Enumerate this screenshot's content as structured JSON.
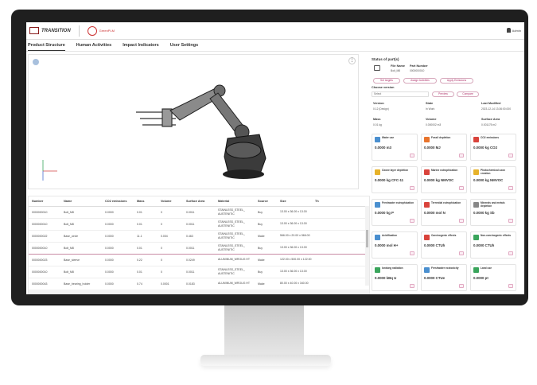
{
  "app": {
    "logo_text": "TRANSITION",
    "brand_text": "GreenPLM",
    "user_name": "Admin"
  },
  "tabs": [
    "Product Structure",
    "Human Activities",
    "Impact Indicators",
    "User Settings"
  ],
  "status": {
    "title": "Status of part(s)",
    "file_name_label": "File Name",
    "file_name_value": "Bolt_M8",
    "part_number_label": "Part Number",
    "part_number_value": "0000000010",
    "actions": [
      "Set targets",
      "Assign Activities",
      "Apply Emissions"
    ],
    "choose_version_label": "Choose version",
    "version_select_value": "Select",
    "preview_label": "Preview",
    "compare_label": "Compare",
    "details": [
      {
        "label": "Version",
        "value": "0.12 (Design)"
      },
      {
        "label": "State",
        "value": "In Work"
      },
      {
        "label": "Last Modified",
        "value": "2023-12-14 13:36:00.000"
      },
      {
        "label": "Mass",
        "value": "0.01 kg"
      },
      {
        "label": "Volume",
        "value": "0.000002 m3"
      },
      {
        "label": "Surface Area",
        "value": "0.001175 m2"
      }
    ]
  },
  "impacts": [
    {
      "title": "Water use",
      "value": "0.0000 m3",
      "color": "#4a8fcf"
    },
    {
      "title": "Fossil depletion",
      "value": "0.0000 MJ",
      "color": "#e8742c"
    },
    {
      "title": "CO2 emissions",
      "value": "0.0000 kg CO2",
      "color": "#d9433b"
    },
    {
      "title": "Ozone layer depletion",
      "value": "0.0000 kg CFC-11",
      "color": "#e6b22a"
    },
    {
      "title": "Marine eutrophication",
      "value": "0.0000 kg NMVOC",
      "color": "#d9433b"
    },
    {
      "title": "Photochemical ozon creation",
      "value": "0.0000 kg NMVOC",
      "color": "#e6b22a"
    },
    {
      "title": "Freshwater eutrophication",
      "value": "0.0000 kg P",
      "color": "#4a8fcf"
    },
    {
      "title": "Terrestial eutrophication",
      "value": "0.0000 mol N",
      "color": "#d9433b"
    },
    {
      "title": "Minerals and metals depletion",
      "value": "0.0000 kg Sb",
      "color": "#888888"
    },
    {
      "title": "Acidification",
      "value": "0.0000 mol H+",
      "color": "#4a8fcf"
    },
    {
      "title": "Carcinogenic effects",
      "value": "0.0000 CTUh",
      "color": "#d9433b"
    },
    {
      "title": "Non-carcinogenic effects",
      "value": "0.0000 CTUh",
      "color": "#3aa55c"
    },
    {
      "title": "Ionising radiation",
      "value": "0.0000 kBq U",
      "color": "#3aa55c"
    },
    {
      "title": "Freshwater ecotoxicity",
      "value": "0.0000 CTUe",
      "color": "#4a8fcf"
    },
    {
      "title": "Land use",
      "value": "0.0000 pt",
      "color": "#3aa55c"
    }
  ],
  "table": {
    "headers": [
      "Number",
      "Name",
      "CO2 emissions",
      "Mass",
      "Volume",
      "Surface Area",
      "Material",
      "Source",
      "Size",
      "Th"
    ],
    "rows": [
      [
        "0000000010",
        "Bolt_M8",
        "0.0000",
        "0.01",
        "0",
        "0.0011",
        "STAINLESS_STEEL_ AUSTENITIC",
        "Buy",
        "13.00 x 36.00 x 13.00"
      ],
      [
        "0000000010",
        "Bolt_M8",
        "0.0000",
        "0.01",
        "0",
        "0.0011",
        "STAINLESS_STEEL_ AUSTENITIC",
        "Buy",
        "13.00 x 36.00 x 13.00"
      ],
      [
        "0000000022",
        "Base_circle",
        "0.0000",
        "11.1",
        "0.004",
        "0.463",
        "STAINLESS_STEEL_ AUSTENITIC",
        "Make",
        "566.00 x 20.00 x 566.00"
      ],
      [
        "0000000010",
        "Bolt_M8",
        "0.0000",
        "0.01",
        "0",
        "0.0011",
        "STAINLESS_STEEL_ AUSTENITIC",
        "Buy",
        "13.00 x 36.00 x 13.00"
      ],
      [
        "0000000023",
        "Base_sleeve",
        "0.0000",
        "0.22",
        "0",
        "0.0249",
        "ALUMINUM_WROUG HT",
        "Make",
        "122.00 x 500.00 x 122.00"
      ],
      [
        "0000000010",
        "Bolt_M8",
        "0.0000",
        "0.01",
        "0",
        "0.0011",
        "STAINLESS_STEEL_ AUSTENITIC",
        "Buy",
        "13.00 x 36.00 x 13.00"
      ],
      [
        "0000000043",
        "Base_bearing_holder",
        "0.0000",
        "0.74",
        "0.0001",
        "0.0183",
        "ALUMINUM_WROUG HT",
        "Make",
        "80.00 x 40.00 x 340.00"
      ],
      [
        "0000000010",
        "Bolt_M8",
        "0.0000",
        "0.01",
        "0",
        "0.0011",
        "STAINLESS_STEEL_ AUSTENITIC",
        "Buy",
        "13.00 x 36.00 x 13.00"
      ]
    ]
  }
}
